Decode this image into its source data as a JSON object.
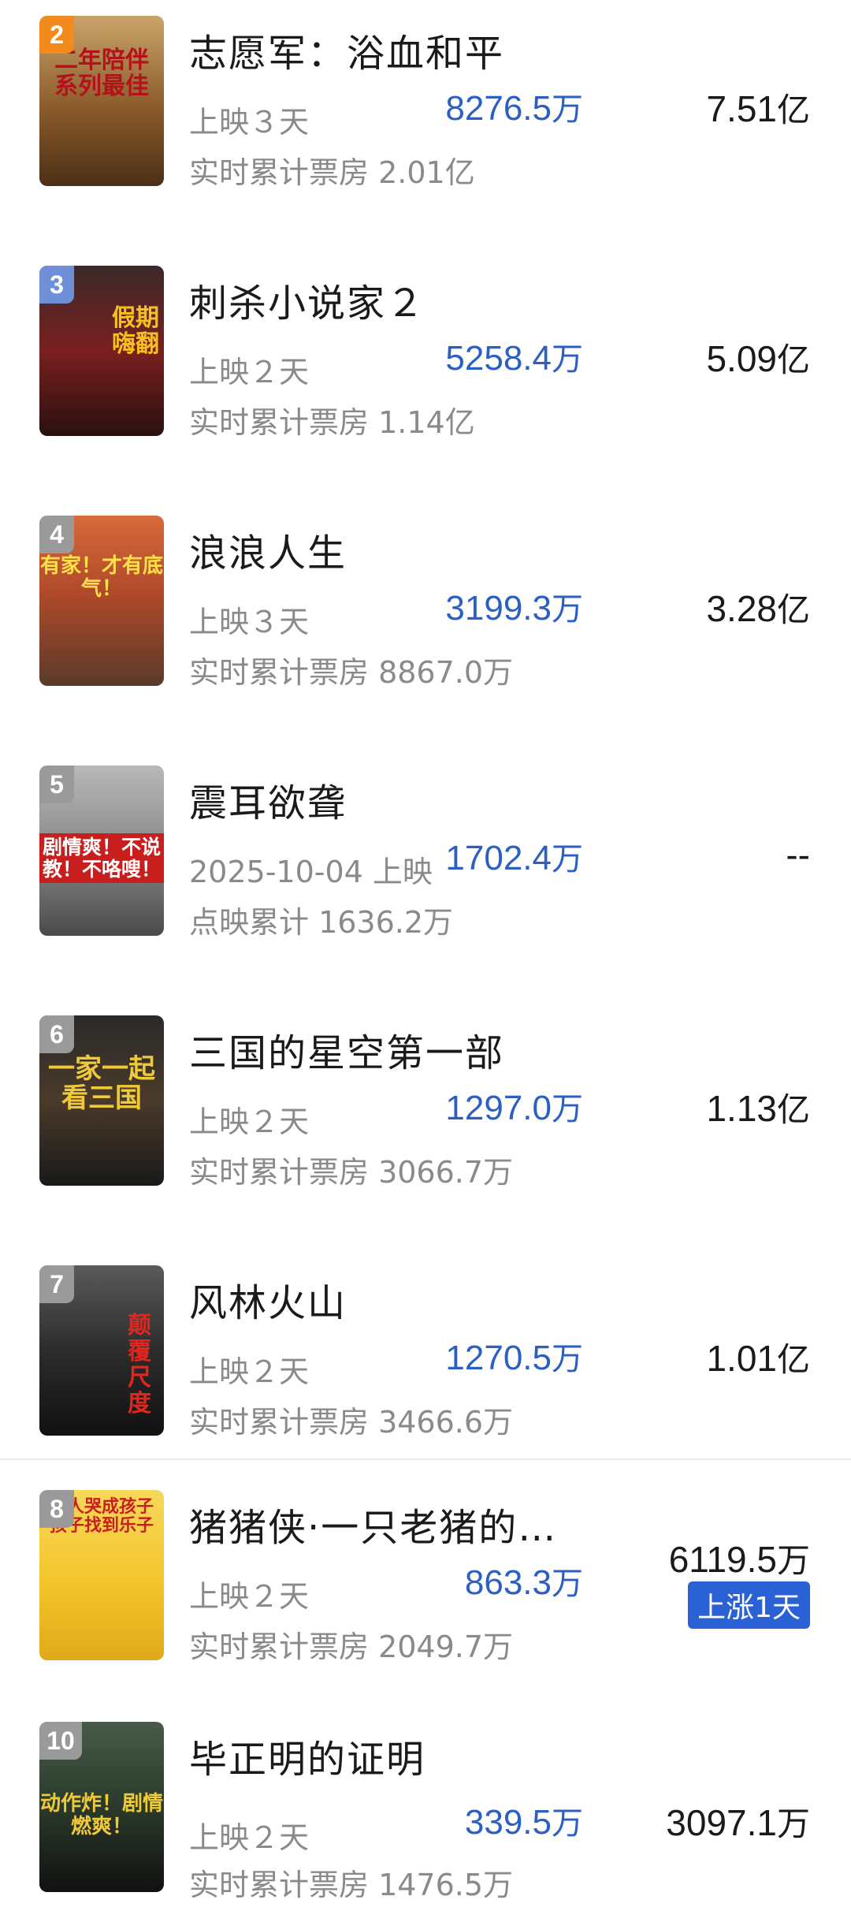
{
  "movies": [
    {
      "rank": "2",
      "title": "志愿军：浴血和平",
      "sub1": "上映３天",
      "daily_num": "8276.5",
      "daily_unit": "万",
      "total_num": "7.51",
      "total_unit": "亿",
      "sub2": "实时累计票房 2.01亿",
      "poster_text": "二年陪伴 系列最佳",
      "rank_color": "#f28a1d",
      "poster_color": "#8a5a2a"
    },
    {
      "rank": "3",
      "title": "刺杀小说家２",
      "sub1": "上映２天",
      "daily_num": "5258.4",
      "daily_unit": "万",
      "total_num": "5.09",
      "total_unit": "亿",
      "sub2": "实时累计票房 1.14亿",
      "poster_text": "假期嗨翻",
      "rank_color": "#6f8fd8",
      "poster_color": "#6a1f1f"
    },
    {
      "rank": "4",
      "title": "浪浪人生",
      "sub1": "上映３天",
      "daily_num": "3199.3",
      "daily_unit": "万",
      "total_num": "3.28",
      "total_unit": "亿",
      "sub2": "实时累计票房 8867.0万",
      "poster_text": "有家！才有底气！",
      "rank_color": "#9a9a9a",
      "poster_color": "#b04a2a"
    },
    {
      "rank": "5",
      "title": "震耳欲聋",
      "sub1": "2025-10-04 上映",
      "daily_num": "1702.4",
      "daily_unit": "万",
      "total_num": "--",
      "total_unit": "",
      "sub2": "点映累计 1636.2万",
      "poster_text": "剧情爽！不说教！不咯嗖！",
      "rank_color": "#9a9a9a",
      "poster_color": "#7d7d7d"
    },
    {
      "rank": "6",
      "title": "三国的星空第一部",
      "sub1": "上映２天",
      "daily_num": "1297.0",
      "daily_unit": "万",
      "total_num": "1.13",
      "total_unit": "亿",
      "sub2": "实时累计票房 3066.7万",
      "poster_text": "一家一起看三国",
      "rank_color": "#9a9a9a",
      "poster_color": "#3a2a1c"
    },
    {
      "rank": "7",
      "title": "风林火山",
      "sub1": "上映２天",
      "daily_num": "1270.5",
      "daily_unit": "万",
      "total_num": "1.01",
      "total_unit": "亿",
      "sub2": "实时累计票房 3466.6万",
      "poster_text": "颠覆尺度",
      "rank_color": "#9a9a9a",
      "poster_color": "#2c2c2c"
    },
    {
      "rank": "8",
      "title": "猪猪侠·一只老猪的…",
      "sub1": "上映２天",
      "daily_num": "863.3",
      "daily_unit": "万",
      "total_num": "6119.5",
      "total_unit": "万",
      "sub2": "实时累计票房 2049.7万",
      "poster_text": "大人哭成孩子 孩子找到乐子",
      "rank_color": "#9a9a9a",
      "poster_color": "#f4c52a",
      "badge": "上涨1天"
    },
    {
      "rank": "10",
      "title": "毕正明的证明",
      "sub1": "上映２天",
      "daily_num": "339.5",
      "daily_unit": "万",
      "total_num": "3097.1",
      "total_unit": "万",
      "sub2": "实时累计票房 1476.5万",
      "poster_text": "动作炸！剧情燃爽！",
      "rank_color": "#9a9a9a",
      "poster_color": "#2a3a2a"
    }
  ]
}
